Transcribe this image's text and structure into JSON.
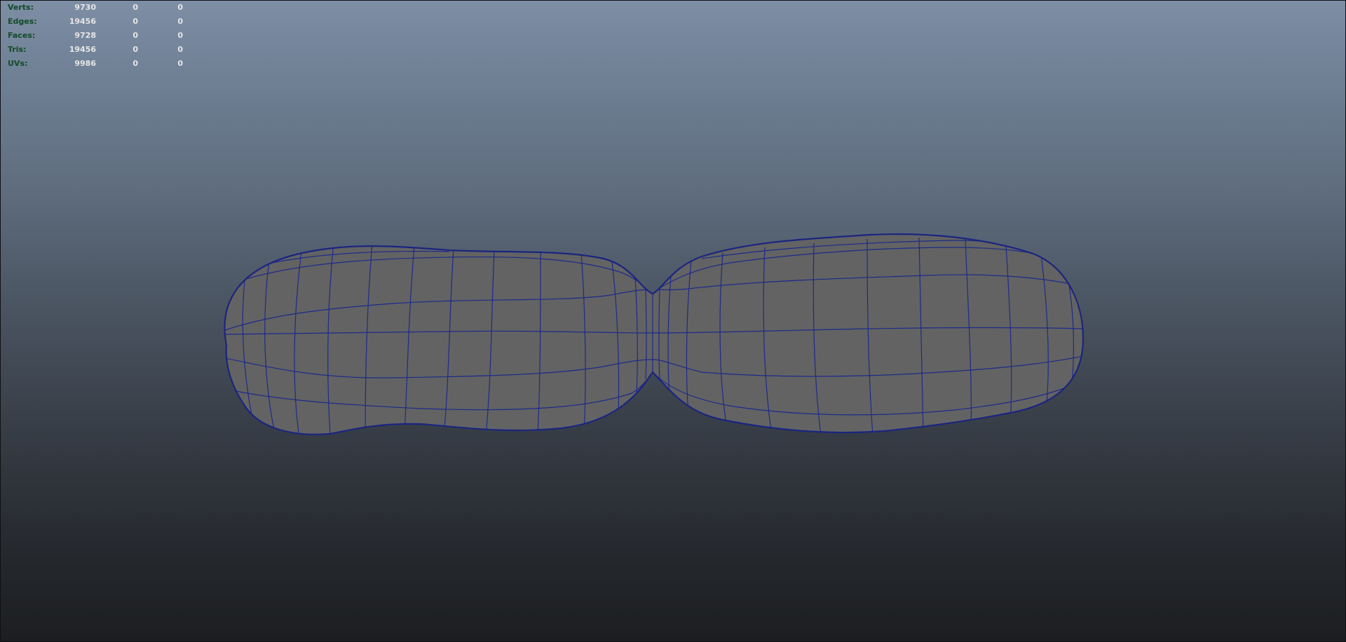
{
  "viewport": {
    "background_top": "#7d8ea5",
    "background_bottom": "#1c1e21",
    "mesh_fill": "#616161",
    "wire_color": "#1d2a8a"
  },
  "heads_up_display": {
    "rows": [
      {
        "label": "Verts:",
        "v1": "9730",
        "v2": "0",
        "v3": "0"
      },
      {
        "label": "Edges:",
        "v1": "19456",
        "v2": "0",
        "v3": "0"
      },
      {
        "label": "Faces:",
        "v1": "9728",
        "v2": "0",
        "v3": "0"
      },
      {
        "label": "Tris:",
        "v1": "19456",
        "v2": "0",
        "v3": "0"
      },
      {
        "label": "UVs:",
        "v1": "9986",
        "v2": "0",
        "v3": "0"
      }
    ]
  }
}
